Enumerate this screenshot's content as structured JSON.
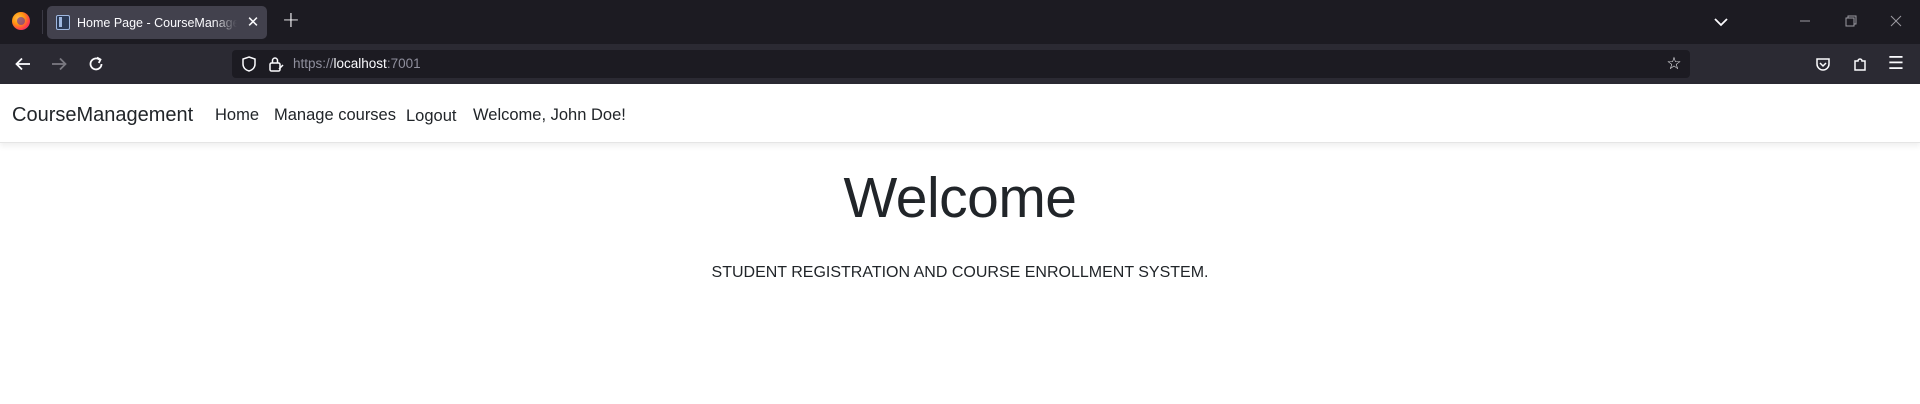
{
  "browser": {
    "tab": {
      "title": "Home Page - CourseManagement",
      "close_glyph": "✕"
    },
    "new_tab_glyph": "+",
    "list_tabs_glyph": "⌄",
    "window_controls": {
      "minimize_glyph": "—",
      "restore_glyph": "❐",
      "close_glyph": "✕"
    },
    "nav": {
      "back_glyph": "←",
      "forward_glyph": "→",
      "reload_glyph": "↻"
    },
    "url": {
      "scheme": "https://",
      "host": "localhost",
      "port": ":7001"
    },
    "icons": {
      "shield": "shield-icon",
      "lock": "lock-icon",
      "star": "star-icon",
      "pocket": "pocket-icon",
      "extensions": "puzzle-icon",
      "menu": "hamburger-menu-icon"
    },
    "star_glyph": "☆",
    "menu_glyph": "☰"
  },
  "site": {
    "brand": "CourseManagement",
    "nav_links": {
      "home": "Home",
      "manage_courses": "Manage courses",
      "logout": "Logout"
    },
    "welcome_user": "Welcome, John Doe!",
    "hero": {
      "title": "Welcome",
      "subtitle": "STUDENT REGISTRATION AND COURSE ENROLLMENT SYSTEM."
    }
  },
  "colors": {
    "tabstrip_bg": "#1c1b22",
    "toolbar_bg": "#2b2a33",
    "active_tab_bg": "#42414d",
    "urlbar_bg": "#1c1b22",
    "page_bg": "#ffffff",
    "page_text": "#212529"
  }
}
